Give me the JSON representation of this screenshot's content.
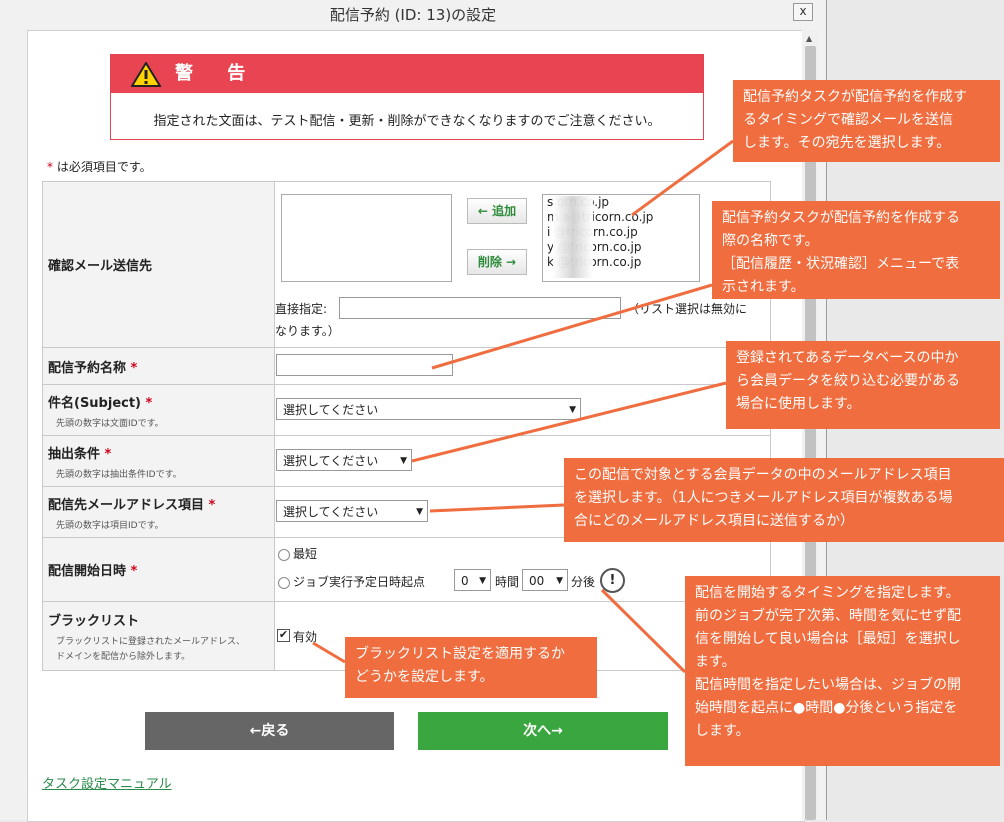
{
  "dialog": {
    "title": "配信予約 (ID: 13)の設定",
    "close": "x"
  },
  "warning": {
    "heading": "警 告",
    "message": "指定された文面は、テスト配信・更新・削除ができなくなりますのでご注意ください。"
  },
  "required_note": {
    "mark": "*",
    "text": " は必須項目です。"
  },
  "fields": {
    "confirm_mail": {
      "label": "確認メール送信先",
      "add": "← 追加",
      "remove": "削除 →",
      "available": [
        "s        orn.co.jp",
        "m        a@tricorn.co.jp",
        "i        @tricorn.co.jp",
        "y        @tricorn.co.jp",
        "k        @tricorn.co.jp"
      ],
      "direct_label": "直接指定:",
      "direct_value": "",
      "direct_note_1": "（リスト選択は無効に",
      "direct_note_2": "なります。）"
    },
    "name": {
      "label": "配信予約名称",
      "value": ""
    },
    "subject": {
      "label": "件名(Subject)",
      "sub": "先頭の数字は文面IDです。",
      "value": "選択してください"
    },
    "condition": {
      "label": "抽出条件",
      "sub": "先頭の数字は抽出条件IDです。",
      "value": "選択してください"
    },
    "mail_field": {
      "label": "配信先メールアドレス項目",
      "sub": "先頭の数字は項目IDです。",
      "value": "選択してください"
    },
    "start": {
      "label": "配信開始日時",
      "opt1": "最短",
      "opt2": "ジョブ実行予定日時起点",
      "hours": "0",
      "hours_unit": "時間",
      "minutes": "00",
      "minutes_unit": "分後",
      "help": "!"
    },
    "blacklist": {
      "label": "ブラックリスト",
      "sub1": "ブラックリストに登録されたメールアドレス、",
      "sub2": "ドメインを配信から除外します。",
      "check_label": "有効",
      "checked": true
    }
  },
  "buttons": {
    "back": "←戻る",
    "next": "次へ→"
  },
  "manual_link": "タスク設定マニュアル",
  "callouts": {
    "c1": [
      "配信予約タスクが配信予約を作成す",
      "るタイミングで確認メールを送信",
      "します。その宛先を選択します。"
    ],
    "c2": [
      "配信予約タスクが配信予約を作成する",
      "際の名称です。",
      "［配信履歴・状況確認］メニューで表",
      "示されます。"
    ],
    "c3": [
      "登録されてあるデータベースの中か",
      "ら会員データを絞り込む必要がある",
      "場合に使用します。"
    ],
    "c4": [
      "この配信で対象とする会員データの中のメールアドレス項目",
      "を選択します。（1人につきメールアドレス項目が複数ある場",
      "合にどのメールアドレス項目に送信するか）"
    ],
    "c5": [
      "配信を開始するタイミングを指定します。",
      "前のジョブが完了次第、時間を気にせず配",
      "信を開始して良い場合は［最短］を選択し",
      "ます。",
      "配信時間を指定したい場合は、ジョブの開",
      "始時間を起点に●時間●分後という指定を",
      "します。"
    ],
    "c6": [
      "ブラックリスト設定を適用するか",
      "どうかを設定します。"
    ]
  },
  "colors": {
    "warning": "#e84452",
    "callout": "#ef6d3f",
    "back": "#666666",
    "next": "#3aa63f"
  }
}
